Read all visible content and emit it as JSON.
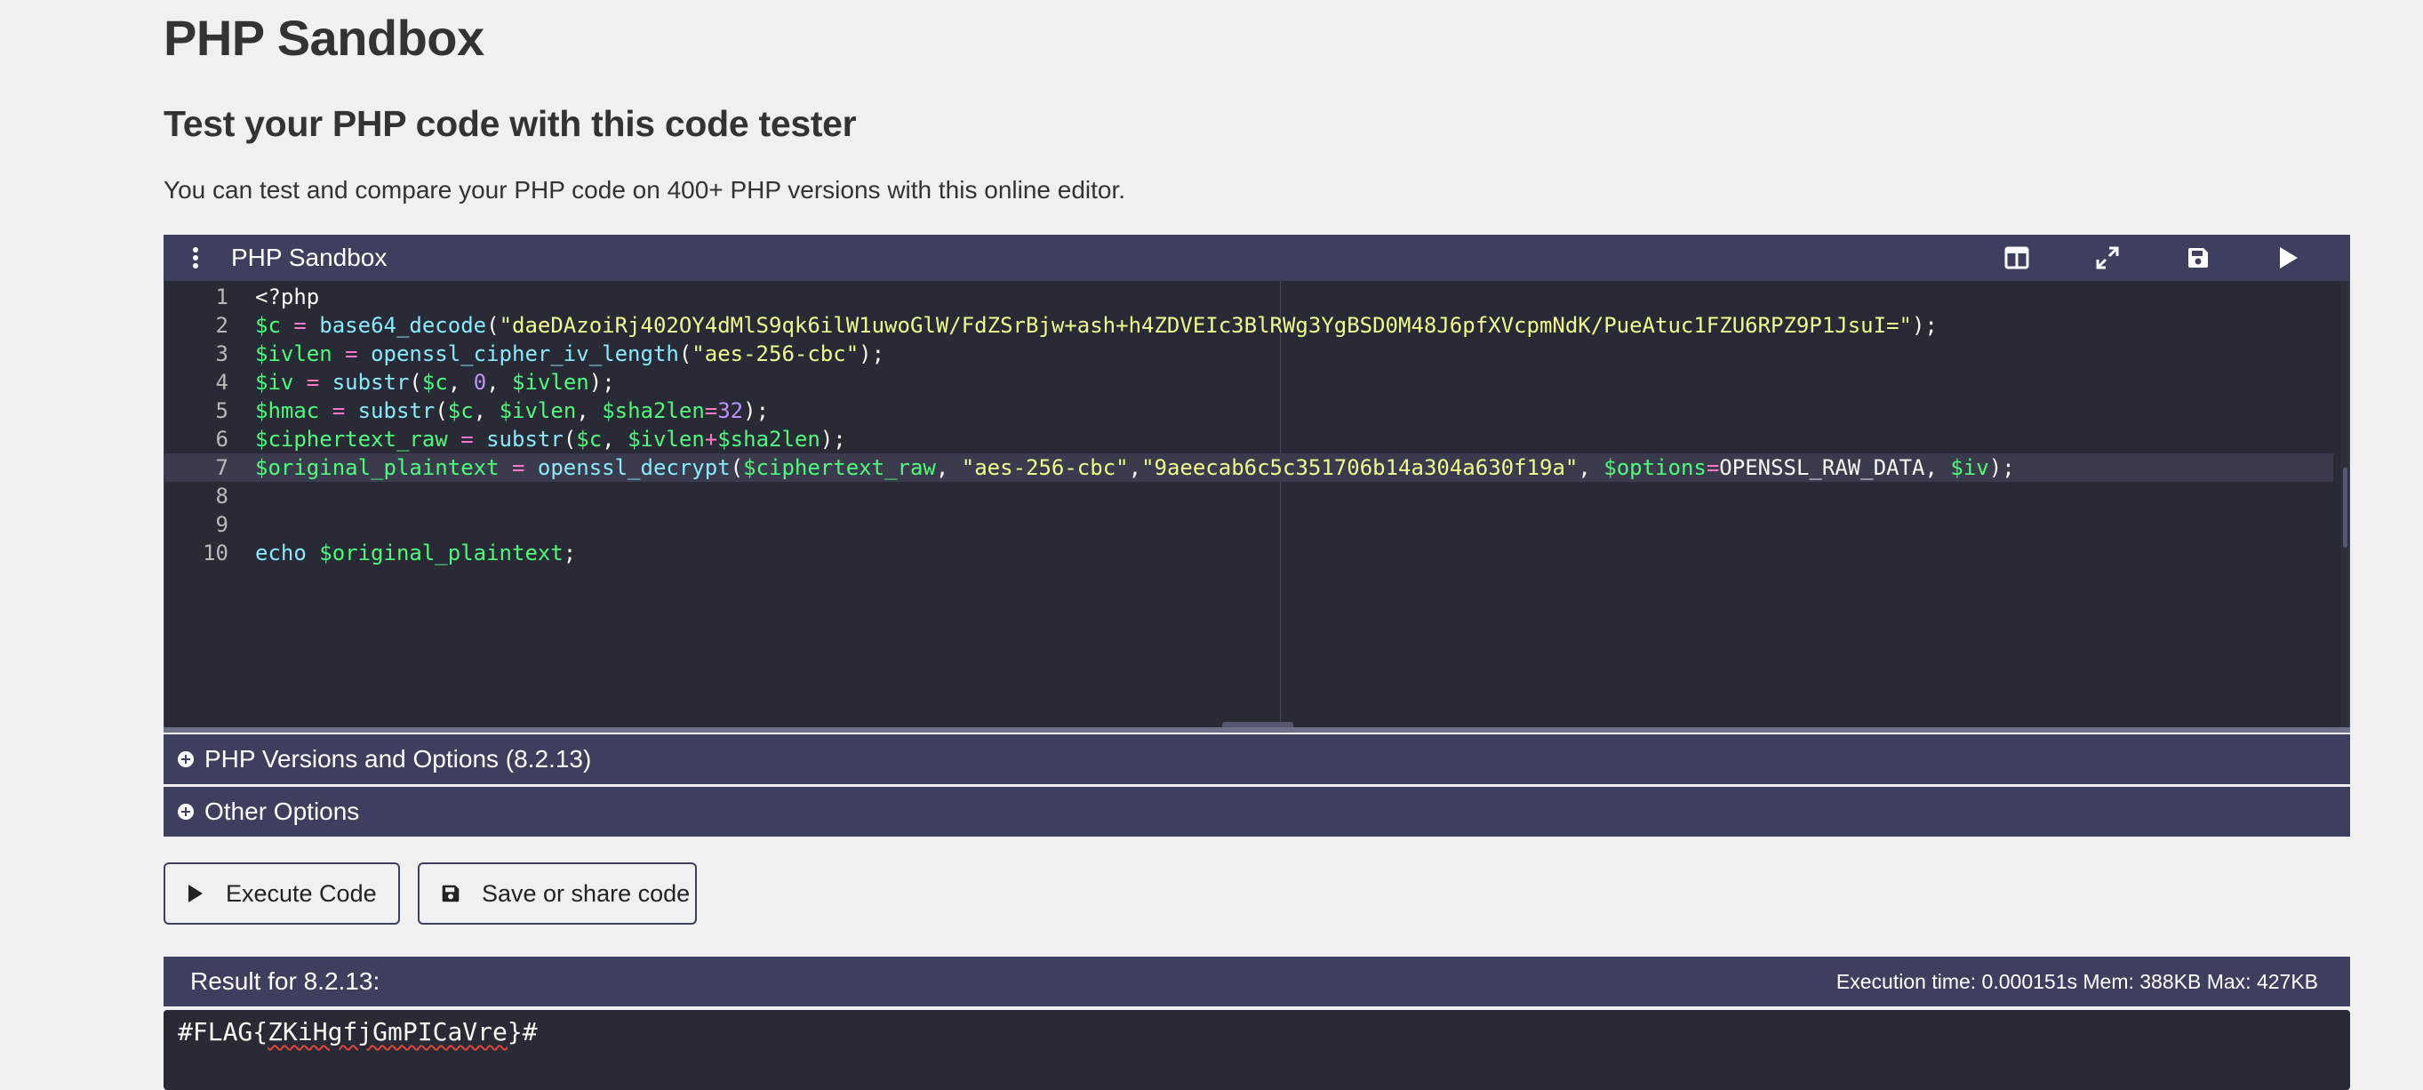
{
  "page": {
    "title": "PHP Sandbox",
    "subtitle": "Test your PHP code with this code tester",
    "intro": "You can test and compare your PHP code on 400+ PHP versions with this online editor."
  },
  "editor": {
    "header_title": "PHP Sandbox",
    "tools": [
      {
        "name": "split-view-icon"
      },
      {
        "name": "expand-icon"
      },
      {
        "name": "save-icon"
      },
      {
        "name": "run-icon"
      }
    ],
    "active_line": 7,
    "lines": [
      {
        "n": "1",
        "tokens": [
          {
            "t": "<?php",
            "c": "tag"
          }
        ]
      },
      {
        "n": "2",
        "tokens": [
          {
            "t": "$c",
            "c": "var"
          },
          {
            "t": " = ",
            "c": "op"
          },
          {
            "t": "base64_decode",
            "c": "fn"
          },
          {
            "t": "(",
            "c": "plain"
          },
          {
            "t": "\"daeDAzoiRj402OY4dMlS9qk6ilW1uwoGlW/FdZSrBjw+ash+h4ZDVEIc3BlRWg3YgBSD0M48J6pfXVcpmNdK/PueAtuc1FZU6RPZ9P1JsuI=\"",
            "c": "str"
          },
          {
            "t": ");",
            "c": "plain"
          }
        ]
      },
      {
        "n": "3",
        "tokens": [
          {
            "t": "$ivlen",
            "c": "var"
          },
          {
            "t": " = ",
            "c": "op"
          },
          {
            "t": "openssl_cipher_iv_length",
            "c": "fn"
          },
          {
            "t": "(",
            "c": "plain"
          },
          {
            "t": "\"aes-256-cbc\"",
            "c": "str"
          },
          {
            "t": ");",
            "c": "plain"
          }
        ]
      },
      {
        "n": "4",
        "tokens": [
          {
            "t": "$iv",
            "c": "var"
          },
          {
            "t": " = ",
            "c": "op"
          },
          {
            "t": "substr",
            "c": "fn"
          },
          {
            "t": "(",
            "c": "plain"
          },
          {
            "t": "$c",
            "c": "var"
          },
          {
            "t": ", ",
            "c": "plain"
          },
          {
            "t": "0",
            "c": "num"
          },
          {
            "t": ", ",
            "c": "plain"
          },
          {
            "t": "$ivlen",
            "c": "var"
          },
          {
            "t": ");",
            "c": "plain"
          }
        ]
      },
      {
        "n": "5",
        "tokens": [
          {
            "t": "$hmac",
            "c": "var"
          },
          {
            "t": " = ",
            "c": "op"
          },
          {
            "t": "substr",
            "c": "fn"
          },
          {
            "t": "(",
            "c": "plain"
          },
          {
            "t": "$c",
            "c": "var"
          },
          {
            "t": ", ",
            "c": "plain"
          },
          {
            "t": "$ivlen",
            "c": "var"
          },
          {
            "t": ", ",
            "c": "plain"
          },
          {
            "t": "$sha2len",
            "c": "var"
          },
          {
            "t": "=",
            "c": "op"
          },
          {
            "t": "32",
            "c": "num"
          },
          {
            "t": ");",
            "c": "plain"
          }
        ]
      },
      {
        "n": "6",
        "tokens": [
          {
            "t": "$ciphertext_raw",
            "c": "var"
          },
          {
            "t": " = ",
            "c": "op"
          },
          {
            "t": "substr",
            "c": "fn"
          },
          {
            "t": "(",
            "c": "plain"
          },
          {
            "t": "$c",
            "c": "var"
          },
          {
            "t": ", ",
            "c": "plain"
          },
          {
            "t": "$ivlen",
            "c": "var"
          },
          {
            "t": "+",
            "c": "op"
          },
          {
            "t": "$sha2len",
            "c": "var"
          },
          {
            "t": ");",
            "c": "plain"
          }
        ]
      },
      {
        "n": "7",
        "tokens": [
          {
            "t": "$original_plaintext",
            "c": "var"
          },
          {
            "t": " = ",
            "c": "op"
          },
          {
            "t": "openssl_decrypt",
            "c": "fn"
          },
          {
            "t": "(",
            "c": "plain"
          },
          {
            "t": "$ciphertext_raw",
            "c": "var"
          },
          {
            "t": ", ",
            "c": "plain"
          },
          {
            "t": "\"aes-256-cbc\"",
            "c": "str"
          },
          {
            "t": ",",
            "c": "plain"
          },
          {
            "t": "\"9aeecab6c5c351706b14a304a630f19a\"",
            "c": "str"
          },
          {
            "t": ", ",
            "c": "plain"
          },
          {
            "t": "$options",
            "c": "var"
          },
          {
            "t": "=",
            "c": "op"
          },
          {
            "t": "OPENSSL_RAW_DATA",
            "c": "plain"
          },
          {
            "t": ", ",
            "c": "plain"
          },
          {
            "t": "$iv",
            "c": "var"
          },
          {
            "t": ");",
            "c": "plain"
          }
        ]
      },
      {
        "n": "8",
        "tokens": []
      },
      {
        "n": "9",
        "tokens": []
      },
      {
        "n": "10",
        "tokens": [
          {
            "t": "echo",
            "c": "kw"
          },
          {
            "t": " ",
            "c": "plain"
          },
          {
            "t": "$original_plaintext",
            "c": "var"
          },
          {
            "t": ";",
            "c": "plain"
          }
        ]
      }
    ]
  },
  "accordions": {
    "versions_label": "PHP Versions and Options (8.2.13)",
    "other_label": "Other Options"
  },
  "buttons": {
    "execute_label": "Execute Code",
    "save_label": "Save or share code"
  },
  "result": {
    "title": "Result for 8.2.13:",
    "meta": "Execution time: 0.000151s Mem: 388KB Max: 427KB",
    "output_prefix": "#FLAG{",
    "output_flag": "ZKiHgfjGmPICaVre",
    "output_suffix": "}#"
  },
  "colors": {
    "header_bg": "#3e3f5e",
    "editor_bg": "#282a36",
    "page_bg": "#f0f0f0"
  }
}
